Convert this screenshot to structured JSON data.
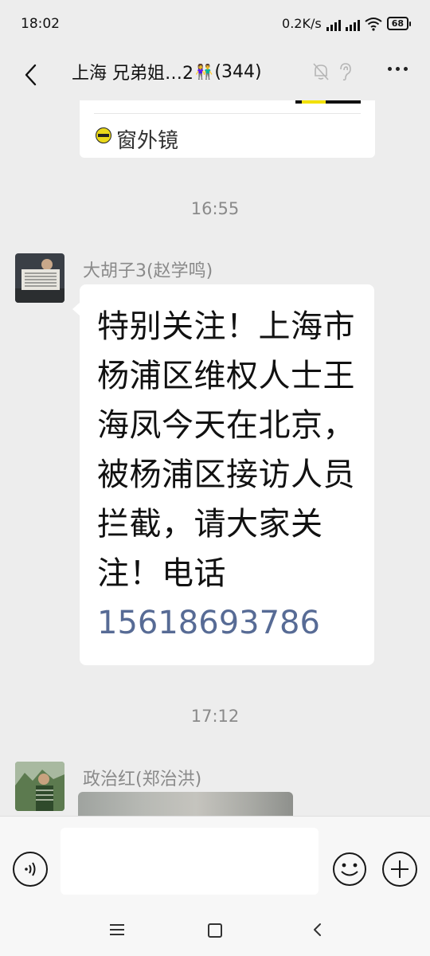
{
  "status_bar": {
    "time": "18:02",
    "network_speed": "0.2K/s",
    "battery": "68"
  },
  "header": {
    "title_prefix": "上海 兄弟姐…2",
    "title_emoji": "👫",
    "member_count": "(344)",
    "icons": [
      "back-arrow-icon",
      "mute-bell-icon",
      "ear-icon",
      "more-icon"
    ]
  },
  "link_card": {
    "source_name": "窗外镜"
  },
  "messages": {
    "timestamp_1": "16:55",
    "msg1": {
      "sender": "大胡子3(赵学鸣)",
      "text": "特别关注！上海市杨浦区维权人士王海凤今天在北京，被杨浦区接访人员拦截，请大家关注！电话",
      "phone": "15618693786"
    },
    "timestamp_2": "17:12",
    "msg2": {
      "sender": "政治红(郑治洪)"
    }
  },
  "input_bar": {
    "placeholder": "",
    "icons": [
      "voice-icon",
      "emoji-icon",
      "plus-icon"
    ]
  },
  "colors": {
    "background": "#ededed",
    "bubble": "#ffffff",
    "link": "#576b95",
    "meta_text": "#8a8a8a"
  }
}
